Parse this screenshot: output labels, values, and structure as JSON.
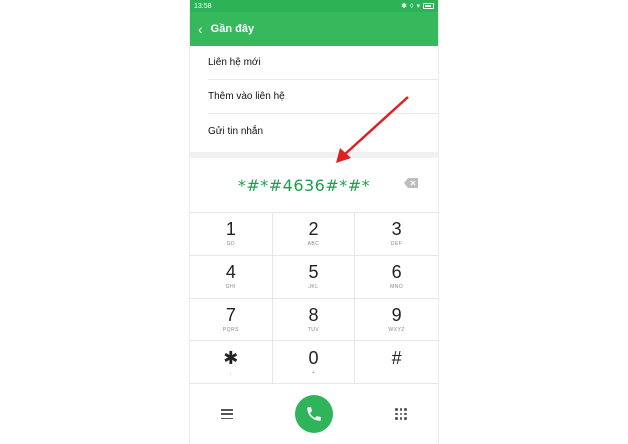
{
  "status_bar": {
    "time": "13:58",
    "icons": [
      "bluetooth-icon",
      "vibrate-icon",
      "wifi-icon",
      "battery-icon"
    ]
  },
  "app_bar": {
    "title": "Gần đây",
    "back_icon": "chevron-left-icon"
  },
  "menu": {
    "items": [
      {
        "label": "Liên hệ mới"
      },
      {
        "label": "Thêm vào liên hệ"
      },
      {
        "label": "Gửi tin nhắn"
      }
    ]
  },
  "display": {
    "number": "*#*#4636#*#*"
  },
  "keypad": {
    "keys": [
      {
        "digit": "1",
        "letters": "GD"
      },
      {
        "digit": "2",
        "letters": "ABC"
      },
      {
        "digit": "3",
        "letters": "DEF"
      },
      {
        "digit": "4",
        "letters": "GHI"
      },
      {
        "digit": "5",
        "letters": "JKL"
      },
      {
        "digit": "6",
        "letters": "MNO"
      },
      {
        "digit": "7",
        "letters": "PQRS"
      },
      {
        "digit": "8",
        "letters": "TUV"
      },
      {
        "digit": "9",
        "letters": "WXYZ"
      },
      {
        "digit": "✱",
        "letters": ","
      },
      {
        "digit": "0",
        "letters": "+"
      },
      {
        "digit": "#",
        "letters": ""
      }
    ]
  },
  "bottom_bar": {
    "icons": [
      "menu-icon",
      "phone-icon",
      "dialpad-icon"
    ]
  },
  "colors": {
    "accent": "#36b85d",
    "status_bar": "#2db257",
    "number_text": "#1f9d4d",
    "call_button": "#2fb35b",
    "annotation_arrow": "#e02020"
  }
}
